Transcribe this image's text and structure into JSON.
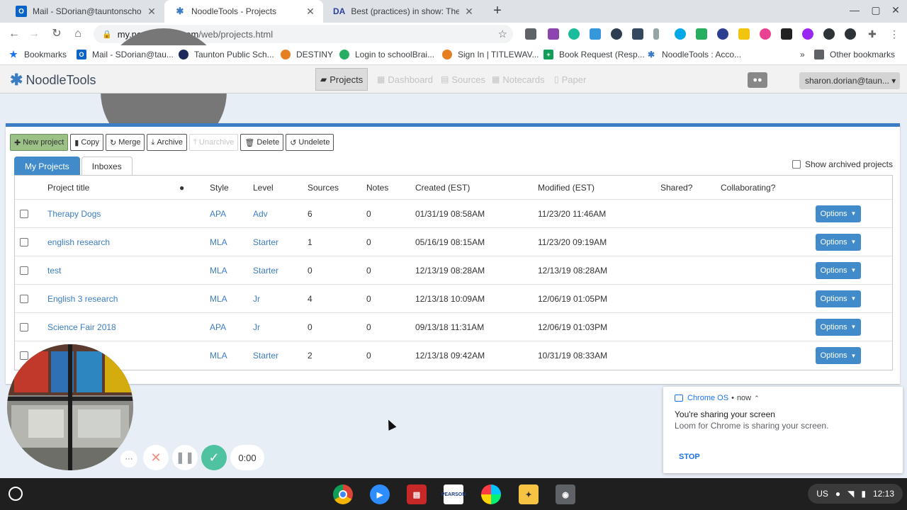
{
  "browser": {
    "tabs": [
      {
        "favicon": "outlook-icon",
        "title": "Mail - SDorian@tauntonschools"
      },
      {
        "favicon": "noodletools-icon",
        "title": "NoodleTools - Projects"
      },
      {
        "favicon": "da-icon",
        "title": "Best (practices) in show: Therap"
      }
    ],
    "url_host": "my.noodletools.com",
    "url_path": "/web/projects.html",
    "bookmarks": [
      "Bookmarks",
      "Mail - SDorian@tau...",
      "Taunton Public Sch...",
      "DESTINY",
      "Login to schoolBrai...",
      "Sign In | TITLEWAV...",
      "Book Request (Resp...",
      "NoodleTools : Acco..."
    ],
    "other_bookmarks": "Other bookmarks",
    "overflow": "»"
  },
  "app": {
    "logo": "NoodleTools",
    "nav": [
      "Projects",
      "Dashboard",
      "Sources",
      "Notecards",
      "Paper"
    ],
    "user": "sharon.dorian@taun..."
  },
  "actions": [
    "New project",
    "Copy",
    "Merge",
    "Archive",
    "Unarchive",
    "Delete",
    "Undelete"
  ],
  "project_tabs": [
    "My Projects",
    "Inboxes"
  ],
  "show_archived": "Show archived projects",
  "table": {
    "headers": [
      "Project title",
      "Style",
      "Level",
      "Sources",
      "Notes",
      "Created (EST)",
      "Modified (EST)",
      "Shared?",
      "Collaborating?"
    ],
    "rows": [
      {
        "title": "Therapy Dogs",
        "style": "APA",
        "level": "Adv",
        "sources": "6",
        "notes": "0",
        "created": "01/31/19 08:58AM",
        "modified": "11/23/20 11:46AM"
      },
      {
        "title": "english research",
        "style": "MLA",
        "level": "Starter",
        "sources": "1",
        "notes": "0",
        "created": "05/16/19 08:15AM",
        "modified": "11/23/20 09:19AM"
      },
      {
        "title": "test",
        "style": "MLA",
        "level": "Starter",
        "sources": "0",
        "notes": "0",
        "created": "12/13/19 08:28AM",
        "modified": "12/13/19 08:28AM"
      },
      {
        "title": "English 3 research",
        "style": "MLA",
        "level": "Jr",
        "sources": "4",
        "notes": "0",
        "created": "12/13/18 10:09AM",
        "modified": "12/06/19 01:05PM"
      },
      {
        "title": "Science Fair 2018",
        "style": "APA",
        "level": "Jr",
        "sources": "0",
        "notes": "0",
        "created": "09/13/18 11:31AM",
        "modified": "12/06/19 01:03PM"
      },
      {
        "title": "",
        "style": "MLA",
        "level": "Starter",
        "sources": "2",
        "notes": "0",
        "created": "12/13/18 09:42AM",
        "modified": "10/31/19 08:33AM"
      }
    ],
    "options_label": "Options"
  },
  "notification": {
    "source": "Chrome OS",
    "time": "now",
    "title": "You're sharing your screen",
    "body": "Loom for Chrome is sharing your screen.",
    "action": "STOP"
  },
  "recorder": {
    "timer": "0:00",
    "more": "···"
  },
  "tray": {
    "locale": "US",
    "time": "12:13"
  },
  "colors": {
    "brand_blue": "#428bca",
    "new_project_green": "#9cc187",
    "panel_accent": "#3b7dc4"
  }
}
